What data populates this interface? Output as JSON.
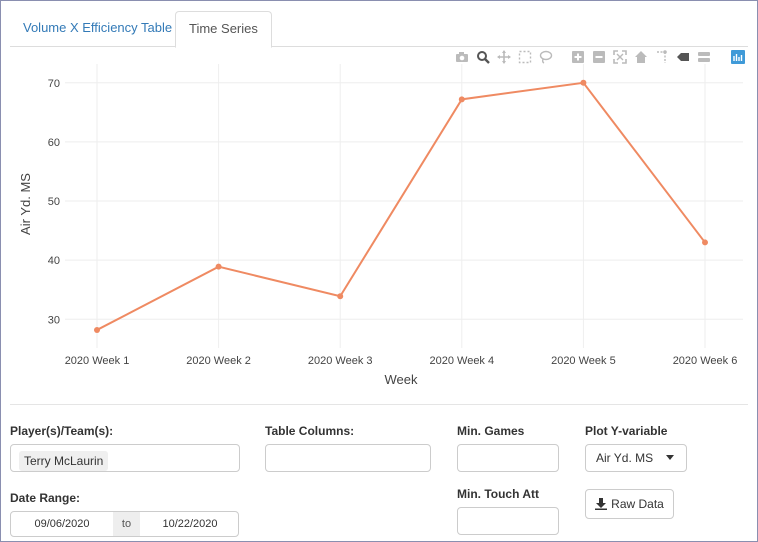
{
  "tabs": [
    {
      "label": "Volume X Efficiency Table",
      "active": false
    },
    {
      "label": "Time Series",
      "active": true
    }
  ],
  "modebar": [
    "camera-icon",
    "zoom-icon",
    "pan-icon",
    "box-select-icon",
    "lasso-icon",
    "zoom-in-icon",
    "zoom-out-icon",
    "autoscale-icon",
    "reset-axes-icon",
    "spike-lines-icon",
    "hover-closest-icon",
    "hover-compare-icon",
    "plotly-logo-icon"
  ],
  "chart_data": {
    "type": "line",
    "categories": [
      "2020 Week 1",
      "2020 Week 2",
      "2020 Week 3",
      "2020 Week 4",
      "2020 Week 5",
      "2020 Week 6"
    ],
    "series": [
      {
        "values": [
          28.2,
          38.9,
          33.9,
          67.2,
          70.0,
          43.0
        ],
        "color": "#ef8a62"
      }
    ],
    "xlabel": "Week",
    "ylabel": "Air Yd. MS",
    "yticks": [
      30,
      40,
      50,
      60,
      70
    ],
    "ylim": [
      26.5,
      72.5
    ],
    "grid": true
  },
  "filters": {
    "player_label": "Player(s)/Team(s):",
    "player_value": "Terry McLaurin",
    "columns_label": "Table Columns:",
    "min_games_label": "Min. Games",
    "plot_y_label": "Plot Y-variable",
    "plot_y_value": "Air Yd. MS",
    "date_label": "Date Range:",
    "date_start": "09/06/2020",
    "date_to": "to",
    "date_end": "10/22/2020",
    "min_touch_label": "Min. Touch Att",
    "raw_data_label": "Raw Data"
  }
}
